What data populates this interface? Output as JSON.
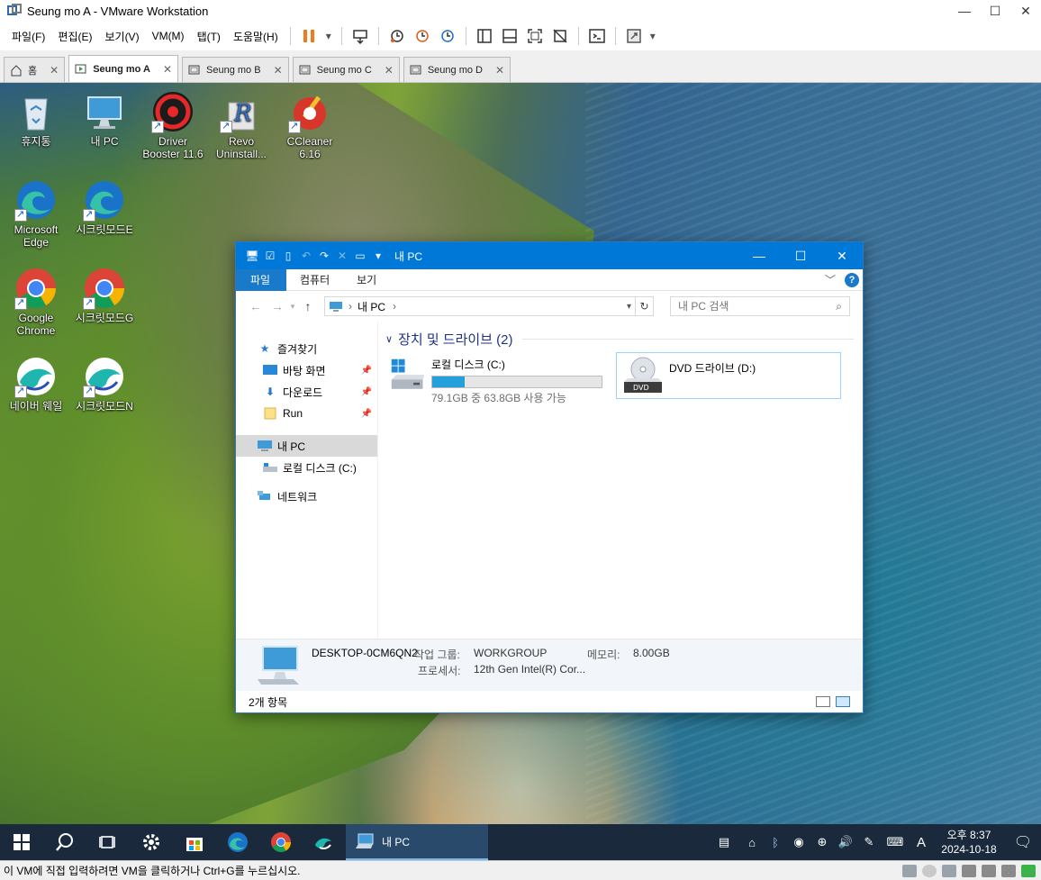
{
  "window": {
    "title": "Seung mo A - VMware Workstation"
  },
  "menu": [
    "파일(F)",
    "편집(E)",
    "보기(V)",
    "VM(M)",
    "탭(T)",
    "도움말(H)"
  ],
  "tabs": [
    {
      "label": "홈",
      "icon": "home-icon"
    },
    {
      "label": "Seung mo A",
      "icon": "vm-running-icon",
      "active": true
    },
    {
      "label": "Seung mo B",
      "icon": "vm-icon"
    },
    {
      "label": "Seung mo C",
      "icon": "vm-icon"
    },
    {
      "label": "Seung mo D",
      "icon": "vm-icon"
    }
  ],
  "desktop_icons": [
    {
      "label": "휴지통",
      "icon": "recycle-bin-icon"
    },
    {
      "label": "내 PC",
      "icon": "this-pc-icon"
    },
    {
      "label": "Driver Booster 11.6",
      "icon": "driver-booster-icon"
    },
    {
      "label": "Revo Uninstall...",
      "icon": "revo-uninstaller-icon"
    },
    {
      "label": "CCleaner 6.16",
      "icon": "ccleaner-icon"
    },
    {
      "label": "Microsoft Edge",
      "icon": "edge-icon"
    },
    {
      "label": "시크릿모드E",
      "icon": "edge-icon"
    },
    {
      "label": "Google Chrome",
      "icon": "chrome-icon"
    },
    {
      "label": "시크릿모드G",
      "icon": "chrome-icon"
    },
    {
      "label": "네이버 웨일",
      "icon": "whale-icon"
    },
    {
      "label": "시크릿모드N",
      "icon": "whale-icon"
    }
  ],
  "explorer": {
    "title": "내 PC",
    "ribbon_tabs": [
      "파일",
      "컴퓨터",
      "보기"
    ],
    "address": "내 PC",
    "search_placeholder": "내 PC 검색",
    "nav": {
      "quick_access": "즐겨찾기",
      "desktop": "바탕 화면",
      "downloads": "다운로드",
      "run": "Run",
      "this_pc": "내 PC",
      "local_disk": "로컬 디스크 (C:)",
      "network": "네트워크"
    },
    "group_title": "장치 및 드라이브 (2)",
    "drives": [
      {
        "name": "로컬 디스크 (C:)",
        "free_text": "79.1GB 중 63.8GB 사용 가능",
        "used_fraction": 0.193
      },
      {
        "name": "DVD 드라이브 (D:)",
        "badge": "DVD"
      }
    ],
    "details": {
      "pc_name": "DESKTOP-0CM6QN2",
      "workgroup_label": "작업 그룹:",
      "workgroup_value": "WORKGROUP",
      "memory_label": "메모리:",
      "memory_value": "8.00GB",
      "processor_label": "프로세서:",
      "processor_value": "12th Gen Intel(R) Cor..."
    },
    "status": "2개 항목"
  },
  "taskbar": {
    "open_app": "내 PC",
    "ime": "A",
    "time": "오후 8:37",
    "date": "2024-10-18"
  },
  "vm_status": "이 VM에 직접 입력하려면 VM을 클릭하거나 Ctrl+G를 누르십시오.",
  "colors": {
    "accent": "#0078d7",
    "taskbar": "#1a2a3c",
    "disk_bar": "#26a0da"
  }
}
